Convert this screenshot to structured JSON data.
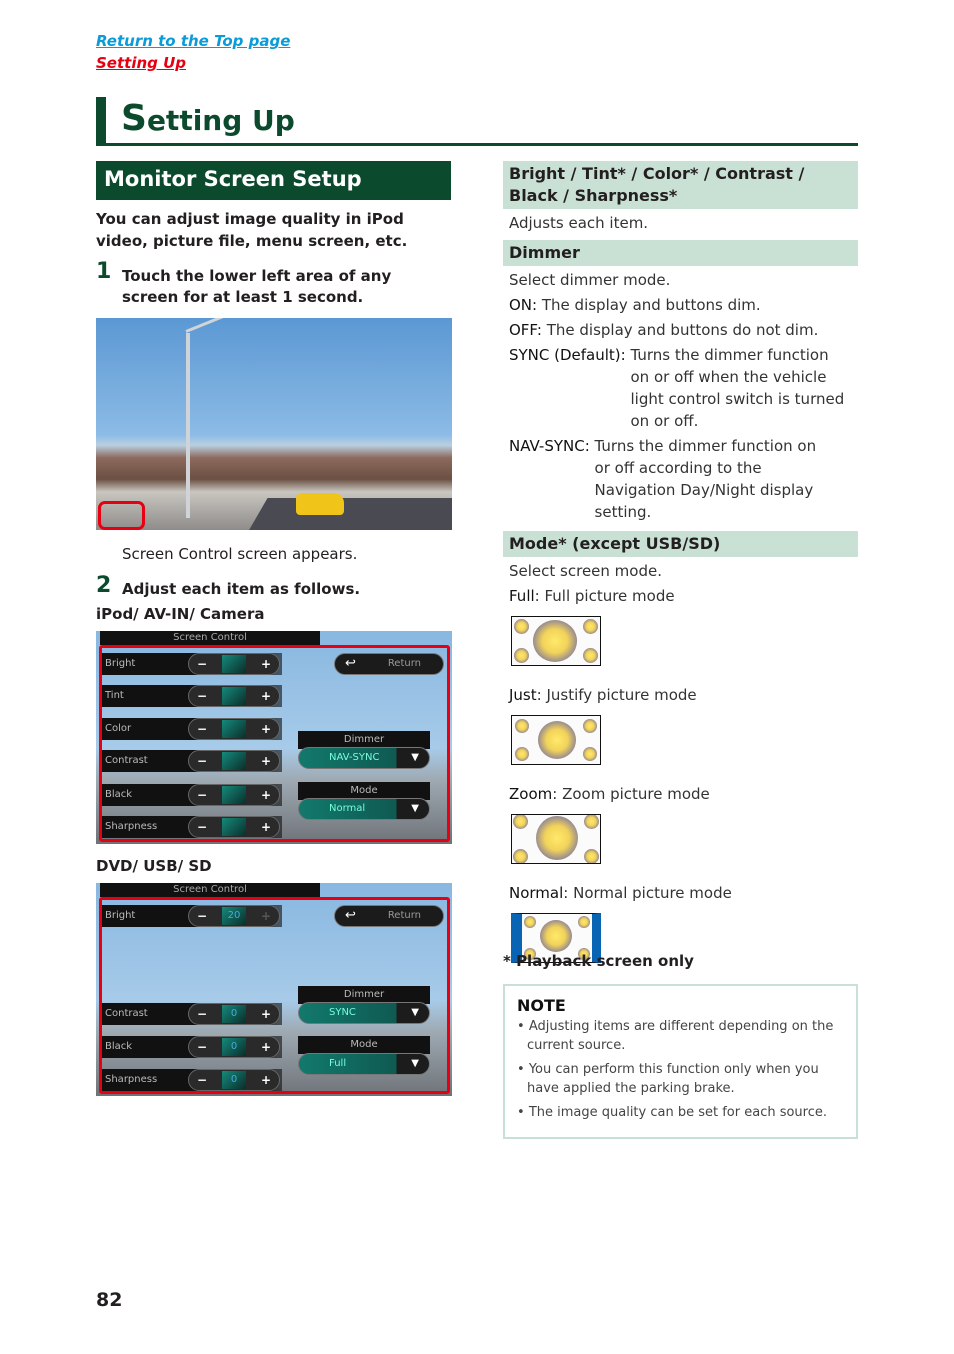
{
  "nav": {
    "return_top": "Return to the Top page",
    "section_link": "Setting Up"
  },
  "page_title_initial": "S",
  "page_title_rest": "etting Up",
  "section": {
    "heading": "Monitor Screen Setup",
    "intro": "You can adjust image quality in iPod video, picture file, menu screen, etc.",
    "step1_num": "1",
    "step1": "Touch the lower left area of any screen for at least 1 second.",
    "step1_caption": "Screen Control screen appears.",
    "step2_num": "2",
    "step2": "Adjust each item as follows."
  },
  "screens": [
    {
      "label": "iPod/ AV-IN/ Camera",
      "title": "Screen Control",
      "rows": [
        {
          "name": "Bright",
          "value": ""
        },
        {
          "name": "Tint",
          "value": ""
        },
        {
          "name": "Color",
          "value": ""
        },
        {
          "name": "Contrast",
          "value": ""
        },
        {
          "name": "Black",
          "value": ""
        },
        {
          "name": "Sharpness",
          "value": ""
        }
      ],
      "return_label": "Return",
      "dimmer_label": "Dimmer",
      "dimmer_value": "NAV-SYNC",
      "mode_label": "Mode",
      "mode_value": "Normal"
    },
    {
      "label": "DVD/ USB/ SD",
      "title": "Screen Control",
      "rows": [
        {
          "name": "Bright",
          "value": "20"
        },
        {
          "name": "Contrast",
          "value": "0"
        },
        {
          "name": "Black",
          "value": "0"
        },
        {
          "name": "Sharpness",
          "value": "0"
        }
      ],
      "return_label": "Return",
      "dimmer_label": "Dimmer",
      "dimmer_value": "SYNC",
      "mode_label": "Mode",
      "mode_value": "Full"
    }
  ],
  "right": {
    "adjust_head": "Bright / Tint* / Color* / Contrast / Black / Sharpness*",
    "adjust_desc": "Adjusts each item.",
    "dimmer_head": "Dimmer",
    "dimmer_desc": "Select dimmer mode.",
    "dimmer_options": [
      {
        "key": "ON:",
        "text": "The display and buttons dim."
      },
      {
        "key": "OFF:",
        "text": "The display and buttons do not dim."
      },
      {
        "key": "SYNC (Default):",
        "text": "Turns the dimmer function on or off when the vehicle light control switch is turned on or off."
      },
      {
        "key": "NAV-SYNC:",
        "text": "Turns the dimmer function on or off according to the Navigation Day/Night display setting."
      }
    ],
    "mode_head": "Mode* (except USB/SD)",
    "mode_desc": "Select screen mode.",
    "modes": [
      {
        "key": "Full",
        "text": ": Full picture mode",
        "icon": "full-mode-icon"
      },
      {
        "key": "Just",
        "text": ": Justify picture mode",
        "icon": "just-mode-icon"
      },
      {
        "key": "Zoom",
        "text": ": Zoom picture mode",
        "icon": "zoom-mode-icon"
      },
      {
        "key": "Normal",
        "text": ": Normal picture mode",
        "icon": "normal-mode-icon"
      }
    ],
    "footnote": "* Playback screen only"
  },
  "note": {
    "title": "NOTE",
    "items": [
      "Adjusting items are different depending on the current source.",
      "You can perform this function only when you have applied the parking brake.",
      "The image quality can be set for each source."
    ]
  },
  "page_number": "82"
}
